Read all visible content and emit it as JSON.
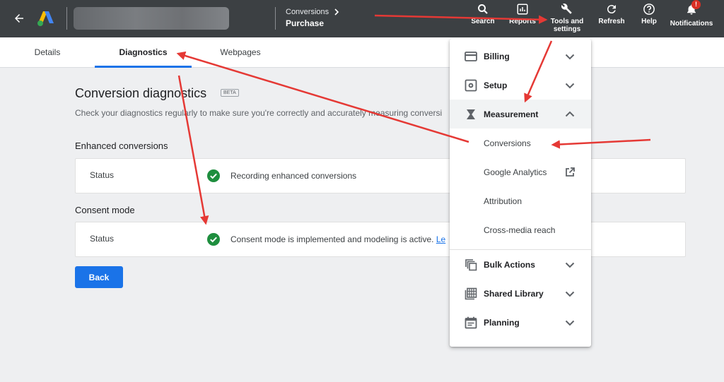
{
  "header": {
    "breadcrumb_parent": "Conversions",
    "breadcrumb_current": "Purchase",
    "tools": [
      {
        "label": "Search",
        "icon": "search-icon"
      },
      {
        "label": "Reports",
        "icon": "reports-icon"
      },
      {
        "label": "Tools and settings",
        "icon": "wrench-icon"
      },
      {
        "label": "Refresh",
        "icon": "refresh-icon"
      },
      {
        "label": "Help",
        "icon": "help-icon"
      },
      {
        "label": "Notifications",
        "icon": "bell-icon",
        "badge": "!"
      }
    ]
  },
  "tabs": [
    {
      "label": "Details",
      "active": false
    },
    {
      "label": "Diagnostics",
      "active": true
    },
    {
      "label": "Webpages",
      "active": false
    }
  ],
  "main": {
    "title": "Conversion diagnostics",
    "beta_badge": "BETA",
    "subtitle": "Check your diagnostics regularly to make sure you're correctly and accurately measuring conversi",
    "sections": [
      {
        "heading": "Enhanced conversions",
        "status_label": "Status",
        "status_text": "Recording enhanced conversions",
        "link": ""
      },
      {
        "heading": "Consent mode",
        "status_label": "Status",
        "status_text": "Consent mode is implemented and modeling is active.",
        "link": "Le"
      }
    ],
    "back_button": "Back"
  },
  "menu": {
    "items": [
      {
        "label": "Billing",
        "icon": "credit-card-icon",
        "type": "head"
      },
      {
        "label": "Setup",
        "icon": "gear-icon",
        "type": "head"
      },
      {
        "label": "Measurement",
        "icon": "hourglass-icon",
        "type": "head",
        "expanded": true
      },
      {
        "label": "Conversions",
        "type": "sub"
      },
      {
        "label": "Google Analytics",
        "type": "sub",
        "icon": "external-link-icon"
      },
      {
        "label": "Attribution",
        "type": "sub"
      },
      {
        "label": "Cross-media reach",
        "type": "sub"
      },
      {
        "label": "Bulk Actions",
        "icon": "copy-icon",
        "type": "head"
      },
      {
        "label": "Shared Library",
        "icon": "library-icon",
        "type": "head"
      },
      {
        "label": "Planning",
        "icon": "calendar-icon",
        "type": "head"
      }
    ]
  },
  "colors": {
    "topbar": "#3c4043",
    "accent": "#1a73e8",
    "success": "#1e8e3e",
    "annotation": "#e53935"
  }
}
